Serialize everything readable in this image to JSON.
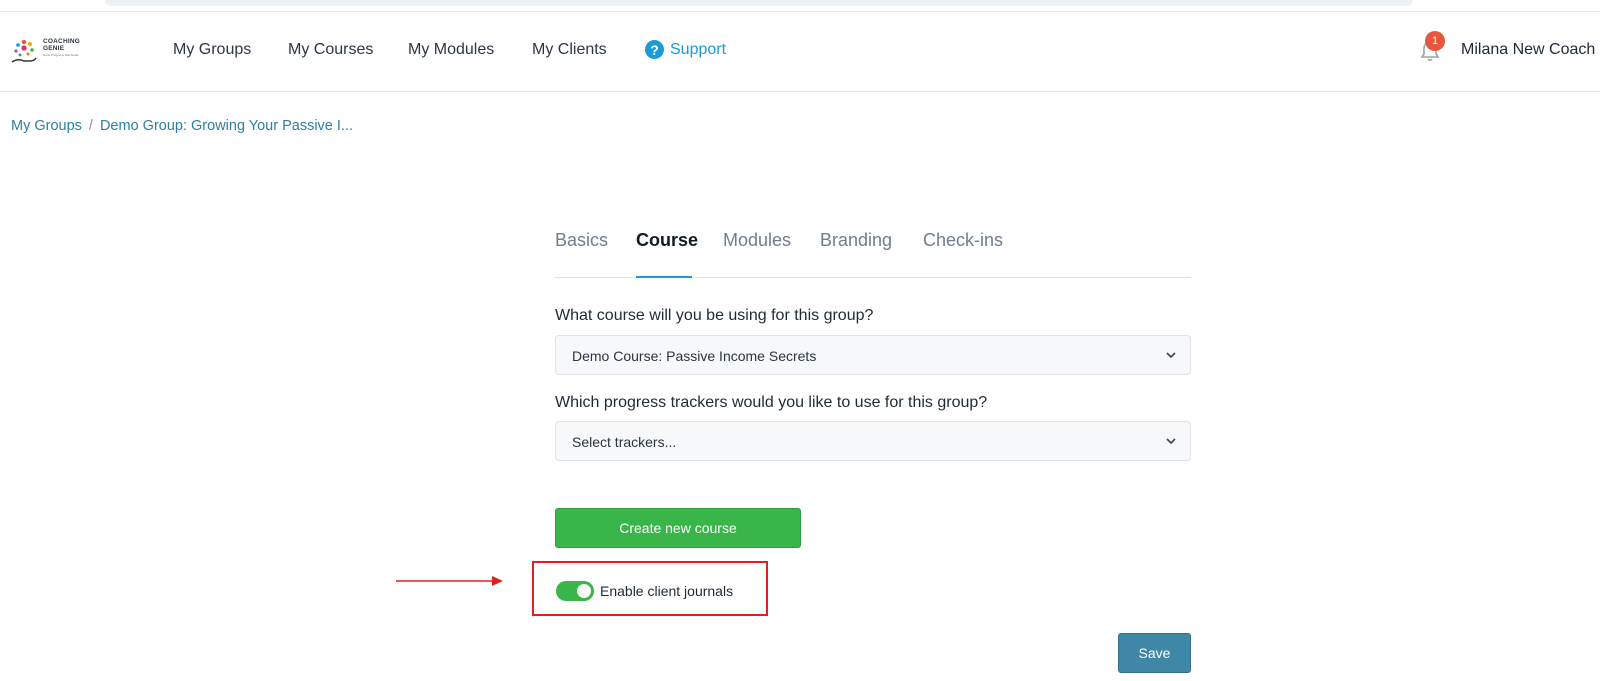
{
  "logo": {
    "line1": "COACHING",
    "line2": "GENIE",
    "tagline": "Grow Programs that Scale"
  },
  "nav": {
    "items": [
      "My Groups",
      "My Courses",
      "My Modules",
      "My Clients"
    ],
    "support_label": "Support",
    "notification_count": "1",
    "user_name": "Milana New Coach L"
  },
  "breadcrumb": {
    "root": "My Groups",
    "separator": "/",
    "current": "Demo Group: Growing Your Passive I..."
  },
  "tabs": [
    "Basics",
    "Course",
    "Modules",
    "Branding",
    "Check-ins"
  ],
  "active_tab": "Course",
  "form": {
    "course_label": "What course will you be using for this group?",
    "course_value": "Demo Course: Passive Income Secrets",
    "trackers_label": "Which progress trackers would you like to use for this group?",
    "trackers_placeholder": "Select trackers...",
    "create_button": "Create new course",
    "journal_toggle_label": "Enable client journals",
    "journal_toggle_on": true,
    "save_button": "Save"
  },
  "colors": {
    "accent": "#1b9ad6",
    "green": "#39b54a",
    "save": "#3f87a6",
    "annotation": "#e02020",
    "badge": "#e6573f"
  },
  "icons": {
    "support": "question-circle-icon",
    "notifications": "bell-icon",
    "dropdown": "chevron-down-icon",
    "annotation": "red-arrow-icon"
  }
}
